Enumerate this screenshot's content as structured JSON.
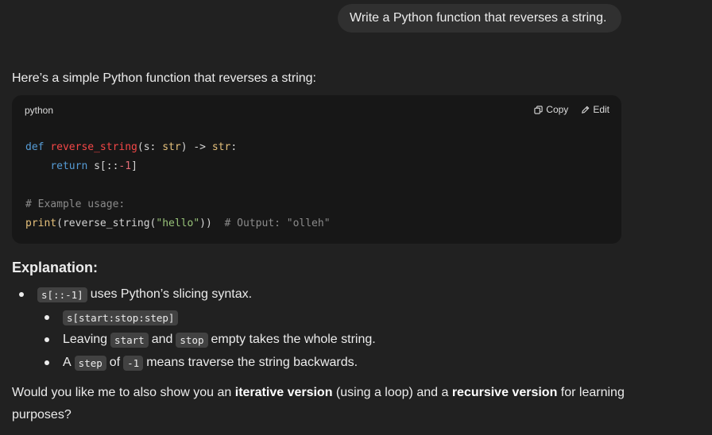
{
  "user_message": "Write a Python function that reverses a string.",
  "intro": "Here’s a simple Python function that reverses a string:",
  "code_block": {
    "language": "python",
    "copy_label": "Copy",
    "edit_label": "Edit",
    "lines": {
      "l1_def": "def",
      "l1_name": "reverse_string",
      "l1_params": "(s: ",
      "l1_type1": "str",
      "l1_arrow": ") -> ",
      "l1_type2": "str",
      "l1_colon": ":",
      "l2_return": "return",
      "l2_expr": " s[::",
      "l2_num": "-1",
      "l2_end": "]",
      "l4_comment": "# Example usage:",
      "l5_print": "print",
      "l5_open": "(reverse_string(",
      "l5_str": "\"hello\"",
      "l5_close": "))  ",
      "l5_comment": "# Output: \"olleh\""
    }
  },
  "explanation": {
    "heading": "Explanation:",
    "b1_code": "s[::-1]",
    "b1_text": "uses Python’s slicing syntax.",
    "b2_code": "s[start:stop:step]",
    "b3_pre": "Leaving",
    "b3_code1": "start",
    "b3_mid": "and",
    "b3_code2": "stop",
    "b3_text": "empty takes the whole string.",
    "b4_pre": "A",
    "b4_code1": "step",
    "b4_mid": "of",
    "b4_code2": "-1",
    "b4_text": "means traverse the string backwards."
  },
  "closing": {
    "p1": "Would you like me to also show you an ",
    "b1": "iterative version",
    "p2": " (using a loop) and a ",
    "b2": "recursive version",
    "p3": " for learning purposes?"
  }
}
